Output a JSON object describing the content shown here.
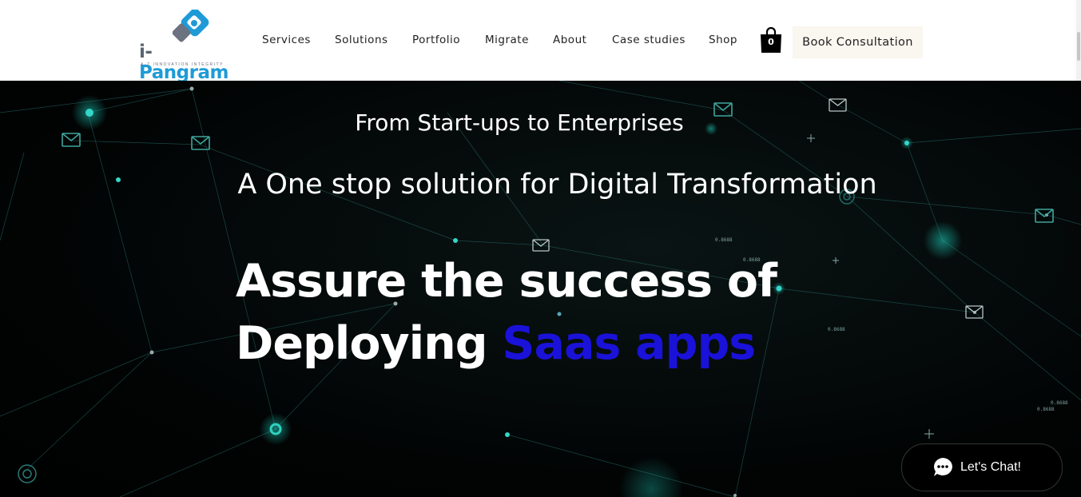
{
  "header": {
    "logo": {
      "name": "i-Pangram",
      "first": "i-",
      "rest": "Pangram",
      "tagline": "A-Z INNOVATION INTEGRITY"
    },
    "nav": [
      {
        "label": "Services"
      },
      {
        "label": "Solutions"
      },
      {
        "label": "Portfolio"
      },
      {
        "label": "Migrate"
      },
      {
        "label": "About"
      },
      {
        "label": "Case studies"
      },
      {
        "label": "Shop"
      }
    ],
    "cart": {
      "count": "0",
      "icon": "shopping-bag-icon"
    },
    "cta": {
      "label": "Book Consultation"
    }
  },
  "hero": {
    "subheading": "From Start-ups to Enterprises",
    "tagline": "A One stop solution for Digital Transformation",
    "headline": {
      "line1": "Assure the success of",
      "line2_prefix": "Deploying",
      "line2_accent": "Saas apps"
    },
    "accent_color": "#1a12d8",
    "background_labels": [
      "0.8688",
      "0.8688",
      "0.8688",
      "0.8688",
      "0.8688"
    ]
  },
  "chat": {
    "label": "Let's Chat!",
    "icon": "chat-bubble-icon"
  },
  "colors": {
    "brand": "#1e9bd7",
    "network_line": "#2a7a76",
    "button_bg": "#faf6f0"
  }
}
